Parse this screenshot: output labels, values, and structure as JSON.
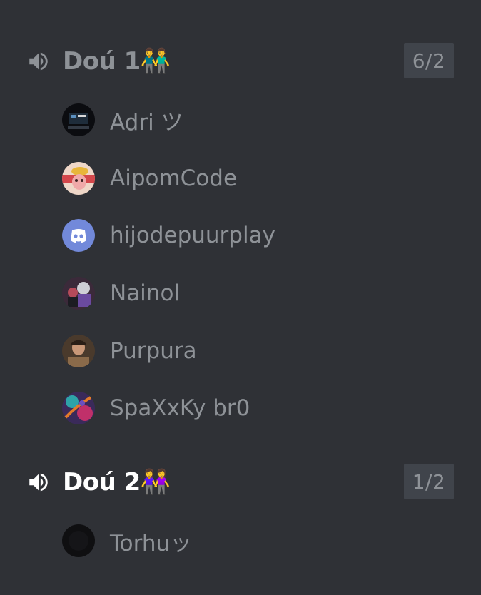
{
  "channels": [
    {
      "name": "Doú 1",
      "emoji": "👬",
      "count": "6/2",
      "members": [
        {
          "name": "Adri ツ"
        },
        {
          "name": "AipomCode"
        },
        {
          "name": "hijodepuurplay"
        },
        {
          "name": "Nainol"
        },
        {
          "name": "Purpura"
        },
        {
          "name": "SpaXxKy br0"
        }
      ]
    },
    {
      "name": "Doú 2",
      "emoji": "👭",
      "count": "1/2",
      "members": [
        {
          "name": "Torhuッ"
        }
      ]
    }
  ],
  "colors": {
    "background": "#2f3136",
    "muted_text": "#8e9297",
    "active_text": "#ffffff",
    "badge_bg": "#40444b",
    "discord_blurple": "#7289da"
  }
}
